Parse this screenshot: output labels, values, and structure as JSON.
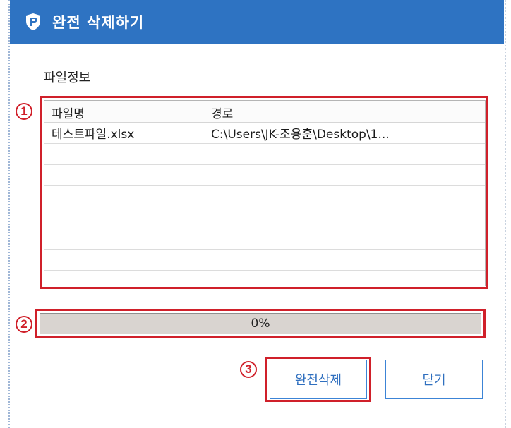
{
  "window": {
    "title": "완전 삭제하기"
  },
  "file_info": {
    "section_label": "파일정보",
    "columns": [
      "파일명",
      "경로"
    ],
    "rows": [
      {
        "name": "테스트파일.xlsx",
        "path": "C:\\Users\\JK-조용훈\\Desktop\\1..."
      }
    ]
  },
  "progress": {
    "value": 0,
    "label": "0%"
  },
  "buttons": {
    "wipe_label": "완전삭제",
    "close_label": "닫기"
  },
  "callouts": [
    "1",
    "2",
    "3"
  ],
  "colors": {
    "titlebar": "#2e73c2",
    "highlight": "#d0202a",
    "button_text": "#2f6fbf"
  }
}
